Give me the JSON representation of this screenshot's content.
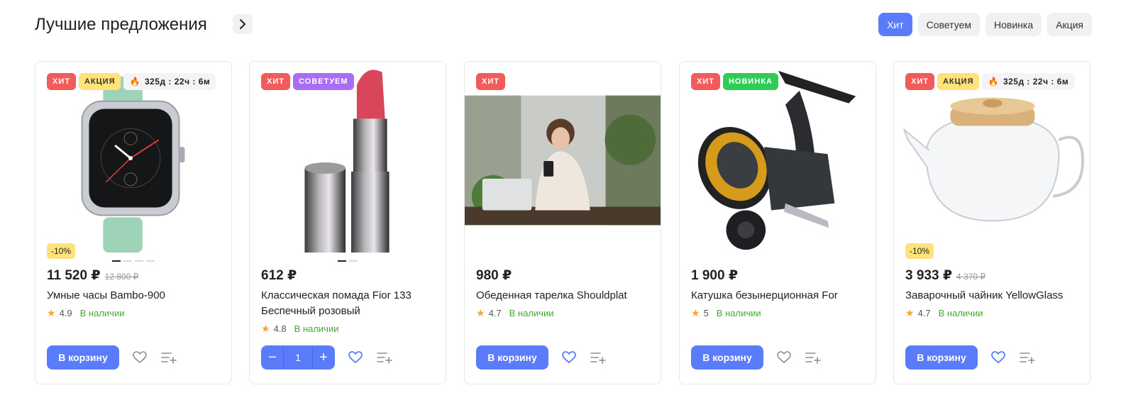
{
  "header": {
    "title": "Лучшие предложения",
    "tabs": [
      {
        "label": "Хит",
        "active": true
      },
      {
        "label": "Советуем",
        "active": false
      },
      {
        "label": "Новинка",
        "active": false
      },
      {
        "label": "Акция",
        "active": false
      }
    ]
  },
  "colors": {
    "accent": "#5b7cfa",
    "hit": "#f15b5b",
    "akcia": "#ffe27a",
    "sovetuem": "#a86cf5",
    "novinka": "#2ecc55",
    "in_stock": "#45a82e"
  },
  "products": [
    {
      "badges": {
        "hit": "ХИТ",
        "akcia": "АКЦИЯ",
        "timer": "325д : 22ч : 6м"
      },
      "discount": "-10%",
      "price": "11 520 ₽",
      "old_price": "12 800 ₽",
      "name": "Умные часы Bambo-900",
      "rating": "4.9",
      "stock": "В наличии",
      "cart_label": "В корзину",
      "favorite_active": false,
      "image": "smartwatch"
    },
    {
      "badges": {
        "hit": "ХИТ",
        "sovetuem": "СОВЕТУЕМ"
      },
      "price": "612 ₽",
      "name": "Классическая помада Fior 133 Беспечный розовый",
      "rating": "4.8",
      "stock": "В наличии",
      "stepper": {
        "minus": "−",
        "value": "1",
        "plus": "+"
      },
      "favorite_active": true,
      "image": "lipstick"
    },
    {
      "badges": {
        "hit": "ХИТ"
      },
      "price": "980 ₽",
      "name": "Обеденная тарелка Shouldplat",
      "rating": "4.7",
      "stock": "В наличии",
      "cart_label": "В корзину",
      "favorite_active": true,
      "image": "woman-with-phone-photo"
    },
    {
      "badges": {
        "hit": "ХИТ",
        "novinka": "НОВИНКА"
      },
      "price": "1 900 ₽",
      "name": "Катушка безынерционная For",
      "rating": "5",
      "stock": "В наличии",
      "cart_label": "В корзину",
      "favorite_active": false,
      "image": "fishing-reel"
    },
    {
      "badges": {
        "hit": "ХИТ",
        "akcia": "АКЦИЯ",
        "timer": "325д : 22ч : 6м"
      },
      "discount": "-10%",
      "price": "3 933 ₽",
      "old_price": "4 370 ₽",
      "name": "Заварочный чайник YellowGlass",
      "rating": "4.7",
      "stock": "В наличии",
      "cart_label": "В корзину",
      "favorite_active": true,
      "image": "glass-teapot"
    }
  ]
}
